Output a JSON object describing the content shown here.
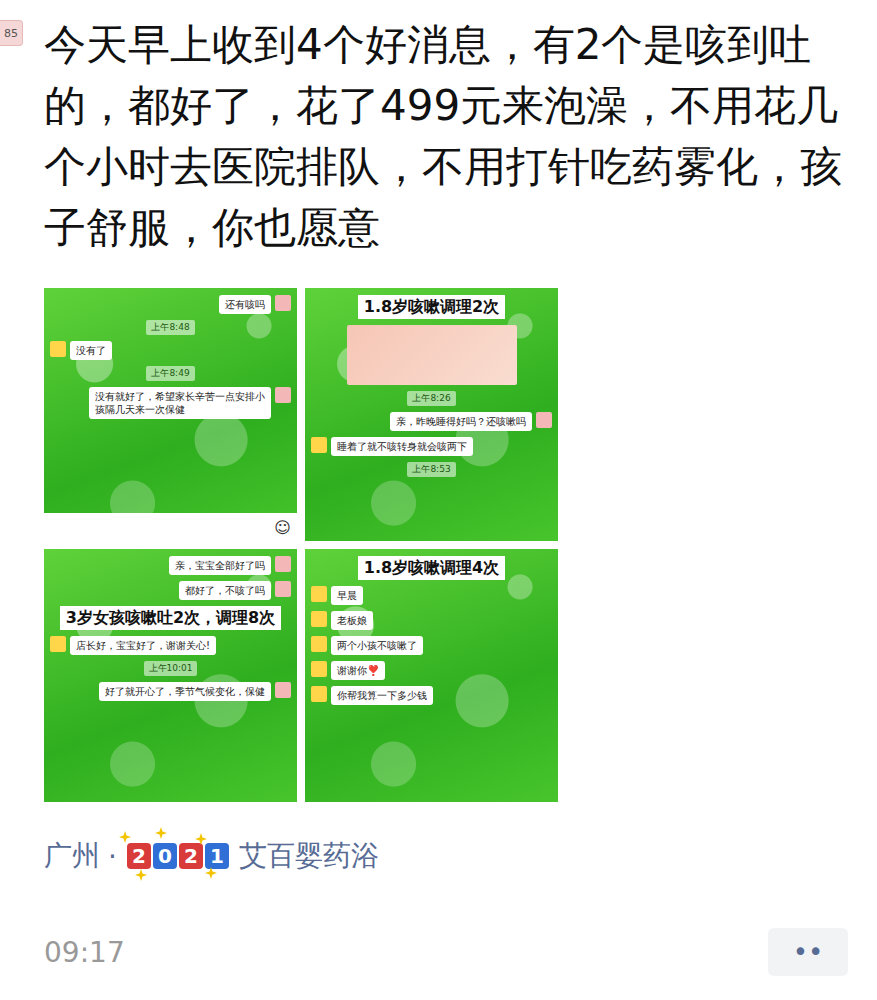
{
  "avatar": {
    "text": "85"
  },
  "post": {
    "text": "今天早上收到4个好消息，有2个是咳到吐的，都好了，花了499元来泡澡，不用花几个小时去医院排队，不用打针吃药雾化，孩子舒服，你也愿意"
  },
  "images": [
    {
      "items": [
        {
          "kind": "bubble",
          "side": "right",
          "text": "还有咳吗"
        },
        {
          "kind": "time",
          "text": "上午8:48"
        },
        {
          "kind": "bubble",
          "side": "left",
          "text": "没有了"
        },
        {
          "kind": "time",
          "text": "上午8:49"
        },
        {
          "kind": "bubble",
          "side": "right",
          "text": "没有就好了，希望家长辛苦一点安排小孩隔几天来一次保健"
        },
        {
          "kind": "input",
          "text": "☺"
        }
      ]
    },
    {
      "items": [
        {
          "kind": "title",
          "text": "1.8岁咳嗽调理2次"
        },
        {
          "kind": "photo",
          "text": ""
        },
        {
          "kind": "time",
          "text": "上午8:26"
        },
        {
          "kind": "bubble",
          "side": "right",
          "text": "亲，昨晚睡得好吗？还咳嗽吗"
        },
        {
          "kind": "bubble",
          "side": "left",
          "text": "睡着了就不咳转身就会咳两下"
        },
        {
          "kind": "time",
          "text": "上午8:53"
        }
      ]
    },
    {
      "items": [
        {
          "kind": "bubble",
          "side": "right",
          "text": "亲，宝宝全部好了吗"
        },
        {
          "kind": "bubble",
          "side": "right",
          "text": "都好了，不咳了吗"
        },
        {
          "kind": "title",
          "text": "3岁女孩咳嗽吐2次，调理8次"
        },
        {
          "kind": "bubble",
          "side": "left",
          "text": "店长好，宝宝好了，谢谢关心!"
        },
        {
          "kind": "time",
          "text": "上午10:01"
        },
        {
          "kind": "bubble",
          "side": "right",
          "text": "好了就开心了，季节气候变化，保健"
        }
      ]
    },
    {
      "items": [
        {
          "kind": "title",
          "text": "1.8岁咳嗽调理4次"
        },
        {
          "kind": "bubble",
          "side": "left",
          "text": "早晨"
        },
        {
          "kind": "bubble",
          "side": "left",
          "text": "老板娘"
        },
        {
          "kind": "bubble",
          "side": "left",
          "text": "两个小孩不咳嗽了"
        },
        {
          "kind": "bubble",
          "side": "left",
          "text": "谢谢你❣️"
        },
        {
          "kind": "bubble",
          "side": "left",
          "text": "你帮我算一下多少钱"
        }
      ]
    }
  ],
  "location": {
    "city": "广州",
    "separator": "·",
    "sticker": "2021",
    "name": "艾百婴药浴"
  },
  "time": "09:17",
  "actions": {
    "icon": "••"
  }
}
